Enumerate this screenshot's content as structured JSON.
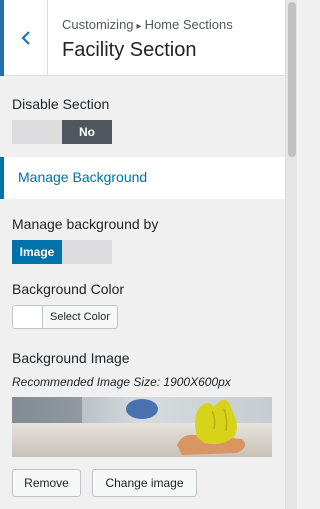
{
  "header": {
    "breadcrumb_parent": "Customizing",
    "breadcrumb_separator": "▸",
    "breadcrumb_child": "Home Sections",
    "title": "Facility Section",
    "back_icon": "chevron-left-icon"
  },
  "disable_section": {
    "label": "Disable Section",
    "selected": "No",
    "options": [
      "",
      "No"
    ]
  },
  "manage_background_section": {
    "label": "Manage Background"
  },
  "manage_background_by": {
    "label": "Manage background by",
    "selected": "Image",
    "options": [
      "Image",
      ""
    ]
  },
  "background_color": {
    "label": "Background Color",
    "button_label": "Select Color",
    "swatch_color": "#ffffff"
  },
  "background_image": {
    "label": "Background Image",
    "hint": "Recommended Image Size: 1900X600px",
    "remove_label": "Remove",
    "change_label": "Change image"
  },
  "colors": {
    "accent": "#0073aa",
    "toggle_dark": "#50575e"
  }
}
